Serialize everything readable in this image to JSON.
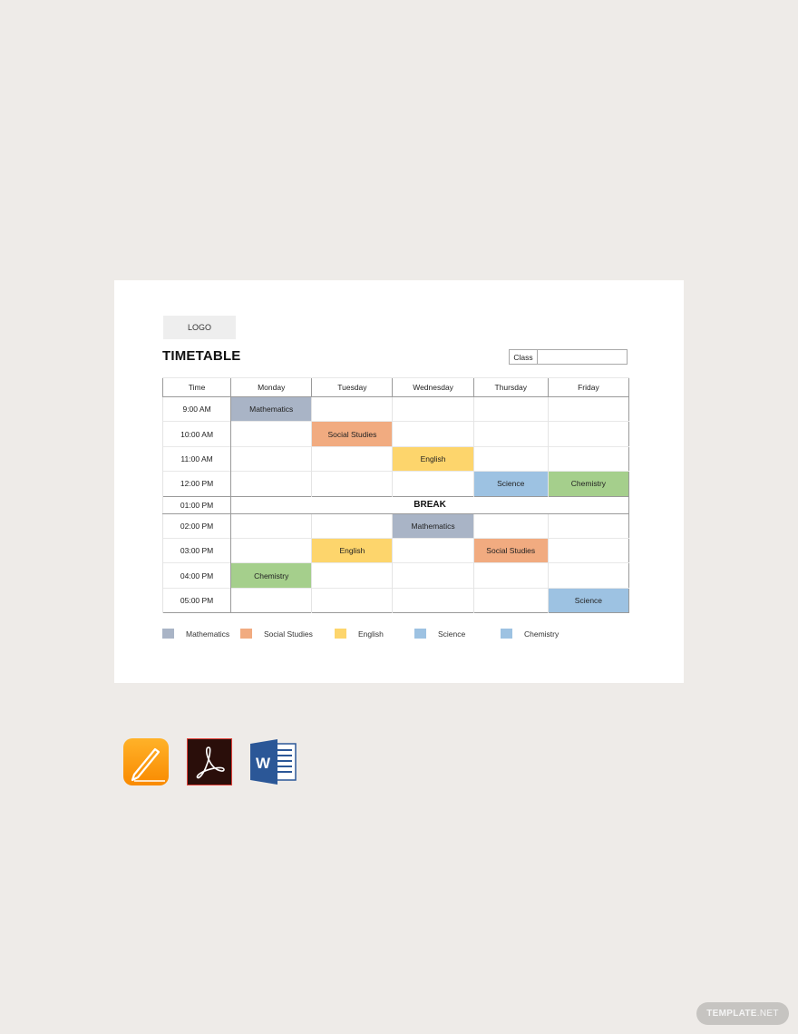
{
  "document": {
    "logo_text": "LOGO",
    "title": "TIMETABLE",
    "class_label": "Class",
    "class_value": ""
  },
  "timetable": {
    "headers": [
      "Time",
      "Monday",
      "Tuesday",
      "Wednesday",
      "Thursday",
      "Friday"
    ],
    "rows": [
      {
        "time": "9:00 AM",
        "cells": [
          "Mathematics",
          "",
          "",
          "",
          ""
        ]
      },
      {
        "time": "10:00 AM",
        "cells": [
          "",
          "Social Studies",
          "",
          "",
          ""
        ]
      },
      {
        "time": "11:00 AM",
        "cells": [
          "",
          "",
          "English",
          "",
          ""
        ]
      },
      {
        "time": "12:00 PM",
        "cells": [
          "",
          "",
          "",
          "Science",
          "Chemistry"
        ]
      },
      {
        "time": "01:00 PM",
        "break": true,
        "label": "BREAK"
      },
      {
        "time": "02:00 PM",
        "cells": [
          "",
          "",
          "Mathematics",
          "",
          ""
        ]
      },
      {
        "time": "03:00 PM",
        "cells": [
          "",
          "English",
          "",
          "Social Studies",
          ""
        ]
      },
      {
        "time": "04:00 PM",
        "cells": [
          "Chemistry",
          "",
          "",
          "",
          ""
        ]
      },
      {
        "time": "05:00 PM",
        "cells": [
          "",
          "",
          "",
          "",
          "Science"
        ]
      }
    ]
  },
  "subject_colors": {
    "Mathematics": "#a9b4c6",
    "Social Studies": "#f1ab80",
    "English": "#fdd56c",
    "Science": "#9dc2e2",
    "Chemistry": "#a5cf8c"
  },
  "legend": [
    {
      "label": "Mathematics",
      "color": "#a9b4c6"
    },
    {
      "label": "Social Studies",
      "color": "#f1ab80"
    },
    {
      "label": "English",
      "color": "#fdd56c"
    },
    {
      "label": "Science",
      "color": "#9dc2e2"
    },
    {
      "label": "Chemistry",
      "color": "#9dc2e2"
    }
  ],
  "formats": [
    {
      "name": "pages-icon",
      "label": "Apple Pages"
    },
    {
      "name": "acrobat-icon",
      "label": "Adobe PDF"
    },
    {
      "name": "word-icon",
      "label": "MS Word"
    }
  ],
  "watermark": {
    "brand": "TEMPLATE",
    "suffix": ".NET"
  }
}
